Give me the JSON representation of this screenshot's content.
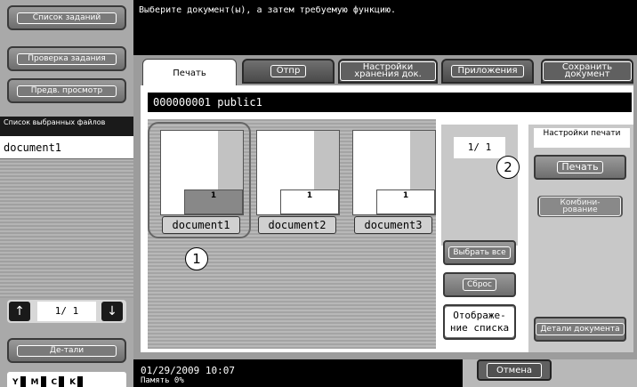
{
  "sidebar": {
    "job_list_label": "Список заданий",
    "check_job_label": "Проверка задания",
    "preview_label": "Предв. просмотр",
    "selected_files_header": "Список выбранных файлов",
    "selected_files": [
      "document1"
    ],
    "pager": {
      "up": "↑",
      "text": "1/ 1",
      "down": "↓"
    },
    "details_label": "Де-тали",
    "toner": [
      "Y",
      "M",
      "C",
      "K"
    ]
  },
  "header": {
    "instruction": "Выберите документ(ы), а затем требуемую функцию."
  },
  "tabs": {
    "print": "Печать",
    "send": "Отпр",
    "storage_settings": "Настройки хранения док.",
    "apps": "Приложения",
    "save_doc": "Сохранить документ"
  },
  "path": "000000001  public1",
  "documents": [
    {
      "name": "document1",
      "count": "1"
    },
    {
      "name": "document2",
      "count": "1"
    },
    {
      "name": "document3",
      "count": "1"
    }
  ],
  "counter": "1/ 1",
  "callouts": {
    "one": "1",
    "two": "2"
  },
  "mid_buttons": {
    "select_all": "Выбрать все",
    "reset": "Сброс",
    "list_view": "Отображе-ние списка"
  },
  "print_settings": {
    "title": "Настройки печати",
    "print": "Печать",
    "combine": "Комбини-рование",
    "doc_details": "Детали документа"
  },
  "status": {
    "datetime": "01/29/2009   10:07",
    "line2": "Память        0%"
  },
  "cancel_label": "Отмена"
}
